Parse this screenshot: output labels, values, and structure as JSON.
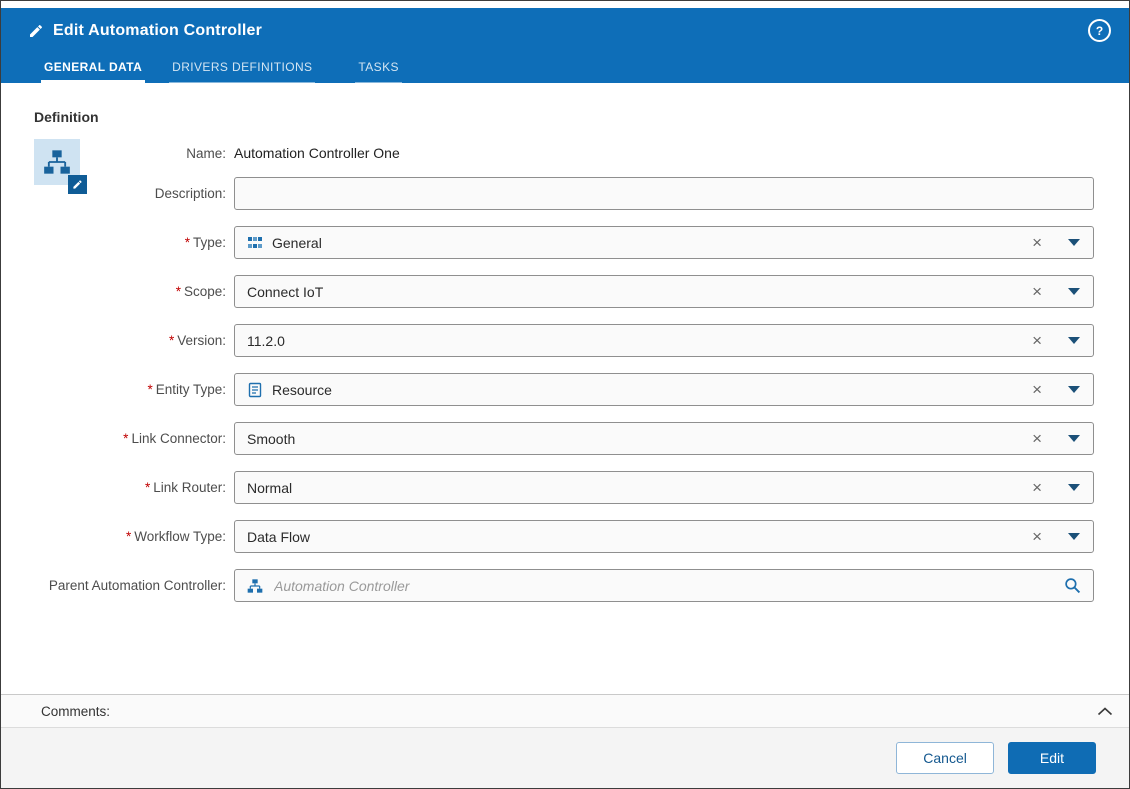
{
  "header": {
    "title": "Edit Automation Controller",
    "help_label": "?",
    "tabs": [
      {
        "label": "GENERAL DATA",
        "active": true
      },
      {
        "label": "DRIVERS DEFINITIONS",
        "active": false
      },
      {
        "label": "TASKS",
        "active": false
      }
    ]
  },
  "section_title": "Definition",
  "glyphs": {
    "required": "*",
    "clear": "×"
  },
  "form": {
    "name": {
      "label": "Name:",
      "value": "Automation Controller One"
    },
    "description": {
      "label": "Description:",
      "value": ""
    },
    "type": {
      "label": "Type:",
      "required": true,
      "value": "General"
    },
    "scope": {
      "label": "Scope:",
      "required": true,
      "value": "Connect IoT"
    },
    "version": {
      "label": "Version:",
      "required": true,
      "value": "11.2.0"
    },
    "entity_type": {
      "label": "Entity Type:",
      "required": true,
      "value": "Resource"
    },
    "link_connector": {
      "label": "Link Connector:",
      "required": true,
      "value": "Smooth"
    },
    "link_router": {
      "label": "Link Router:",
      "required": true,
      "value": "Normal"
    },
    "workflow_type": {
      "label": "Workflow Type:",
      "required": true,
      "value": "Data Flow"
    },
    "parent": {
      "label": "Parent Automation Controller:",
      "placeholder": "Automation Controller"
    }
  },
  "comments": {
    "label": "Comments:"
  },
  "footer": {
    "cancel_label": "Cancel",
    "edit_label": "Edit"
  },
  "colors": {
    "header_blue": "#0e6eb8",
    "button_blue": "#0f6cb4",
    "icon_blue": "#1e6fae",
    "required_red": "#c00000"
  }
}
